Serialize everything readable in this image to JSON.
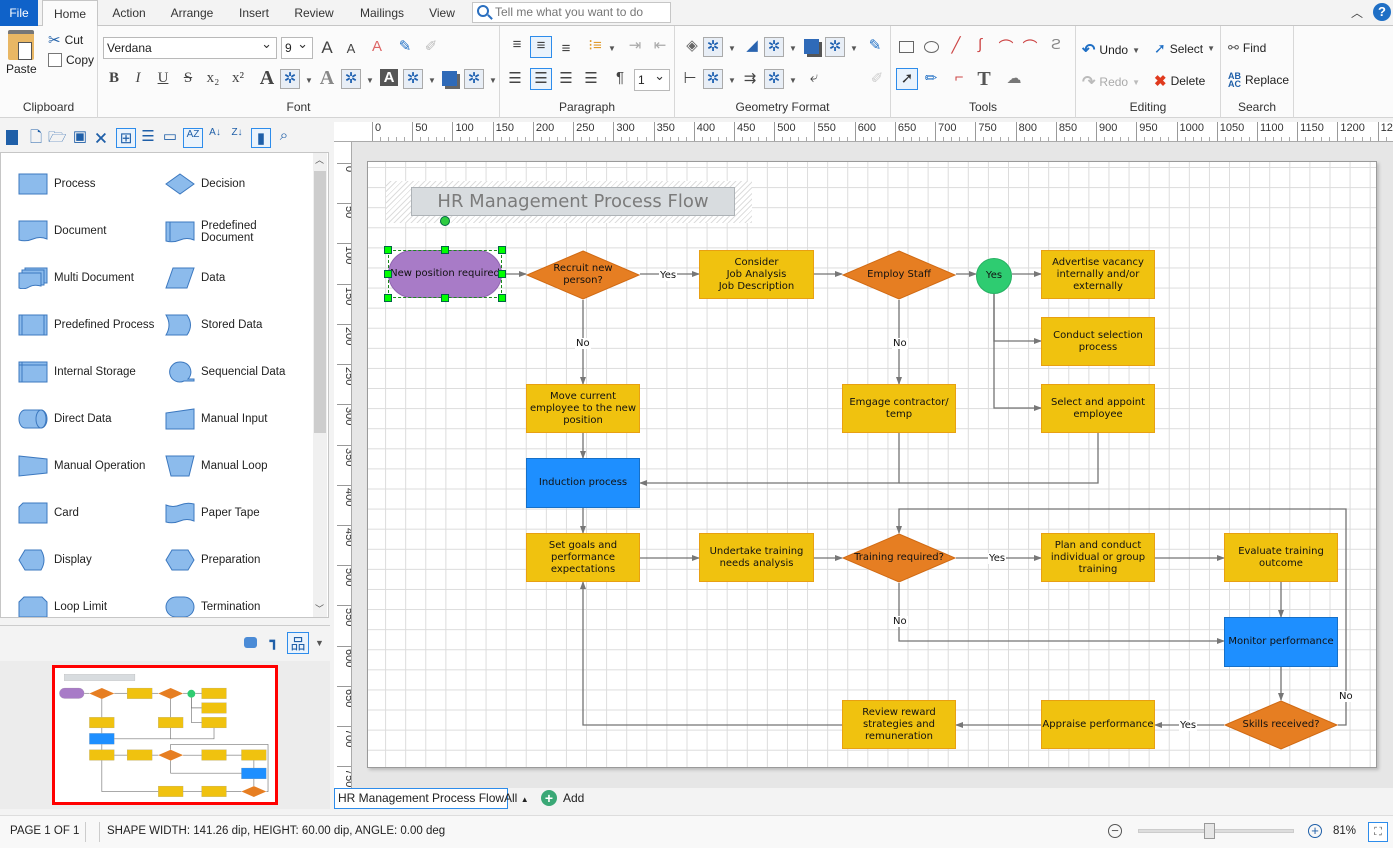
{
  "menu": {
    "file": "File",
    "tabs": [
      "Home",
      "Action",
      "Arrange",
      "Insert",
      "Review",
      "Mailings",
      "View"
    ],
    "active_tab": "Home",
    "tell_me_placeholder": "Tell me what you want to do"
  },
  "ribbon": {
    "clipboard": {
      "label": "Clipboard",
      "paste": "Paste",
      "cut": "Cut",
      "copy": "Copy"
    },
    "font": {
      "label": "Font",
      "family": "Verdana",
      "size": "9"
    },
    "paragraph": {
      "label": "Paragraph",
      "spacing": "1"
    },
    "geometry": {
      "label": "Geometry Format"
    },
    "tools": {
      "label": "Tools"
    },
    "editing": {
      "label": "Editing",
      "undo": "Undo",
      "redo": "Redo",
      "select": "Select",
      "delete": "Delete"
    },
    "search": {
      "label": "Search",
      "find": "Find",
      "replace": "Replace"
    }
  },
  "shapes_panel": {
    "items": [
      {
        "label": "Process",
        "icon": "process-shape"
      },
      {
        "label": "Decision",
        "icon": "decision-shape"
      },
      {
        "label": "Document",
        "icon": "document-shape"
      },
      {
        "label": "Predefined Document",
        "icon": "predefined-document-shape"
      },
      {
        "label": "Multi Document",
        "icon": "multi-document-shape"
      },
      {
        "label": "Data",
        "icon": "data-shape"
      },
      {
        "label": "Predefined Process",
        "icon": "predefined-process-shape"
      },
      {
        "label": "Stored Data",
        "icon": "stored-data-shape"
      },
      {
        "label": "Internal Storage",
        "icon": "internal-storage-shape"
      },
      {
        "label": "Sequencial Data",
        "icon": "sequential-data-shape"
      },
      {
        "label": "Direct Data",
        "icon": "direct-data-shape"
      },
      {
        "label": "Manual Input",
        "icon": "manual-input-shape"
      },
      {
        "label": "Manual Operation",
        "icon": "manual-operation-shape"
      },
      {
        "label": "Manual Loop",
        "icon": "manual-loop-shape"
      },
      {
        "label": "Card",
        "icon": "card-shape"
      },
      {
        "label": "Paper Tape",
        "icon": "paper-tape-shape"
      },
      {
        "label": "Display",
        "icon": "display-shape"
      },
      {
        "label": "Preparation",
        "icon": "preparation-shape"
      },
      {
        "label": "Loop Limit",
        "icon": "loop-limit-shape"
      },
      {
        "label": "Termination",
        "icon": "termination-shape"
      }
    ]
  },
  "ruler": {
    "unit": "dip",
    "h_ticks": [
      "0",
      "50",
      "100",
      "150",
      "200",
      "250",
      "300",
      "350",
      "400",
      "450",
      "500",
      "550",
      "600",
      "650",
      "700",
      "750",
      "800",
      "850",
      "900",
      "950",
      "1000",
      "1050",
      "1100",
      "1150",
      "1200",
      "12"
    ],
    "v_ticks": [
      "0",
      "50",
      "100",
      "150",
      "200",
      "250",
      "300",
      "350",
      "400",
      "450",
      "500",
      "550",
      "600",
      "650",
      "700",
      "750"
    ]
  },
  "diagram": {
    "title": "HR Management Process Flow",
    "nodes": {
      "start": "New position required",
      "recruit": "Recruit new person?",
      "consider": "Consider\nJob Analysis\nJob Description",
      "employ": "Employ Staff",
      "yes_circle": "Yes",
      "advertise": "Advertise vacancy internally and/or externally",
      "selection": "Conduct selection process",
      "appoint": "Select and appoint employee",
      "move": "Move current employee to the new position",
      "contractor": "Emgage contractor/ temp",
      "induction": "Induction process",
      "goals": "Set goals and performance expectations",
      "tna": "Undertake training needs analysis",
      "training_req": "Training required?",
      "plan": "Plan and conduct individual or group training",
      "evaluate": "Evaluate training outcome",
      "monitor": "Monitor performance",
      "skills": "Skills received?",
      "appraise": "Appraise performance",
      "review": "Review reward strategies and remuneration"
    },
    "edge_labels": {
      "recruit_yes": "Yes",
      "recruit_no": "No",
      "employ_no": "No",
      "training_yes": "Yes",
      "training_no": "No",
      "skills_yes": "Yes",
      "skills_no": "No"
    },
    "colors": {
      "process": "#f0c20f",
      "decision": "#e67e22",
      "start": "#a87bc7",
      "highlight": "#1e8fff",
      "yes": "#2ecc71"
    }
  },
  "page_tabs": {
    "current": "HR Management Process Flow",
    "all": "All",
    "add": "Add"
  },
  "status": {
    "page": "PAGE 1 OF 1",
    "shape_info": "SHAPE WIDTH: 141.26 dip, HEIGHT: 60.00 dip, ANGLE: 0.00 deg",
    "zoom": "81%",
    "zoom_fraction": 0.45
  }
}
